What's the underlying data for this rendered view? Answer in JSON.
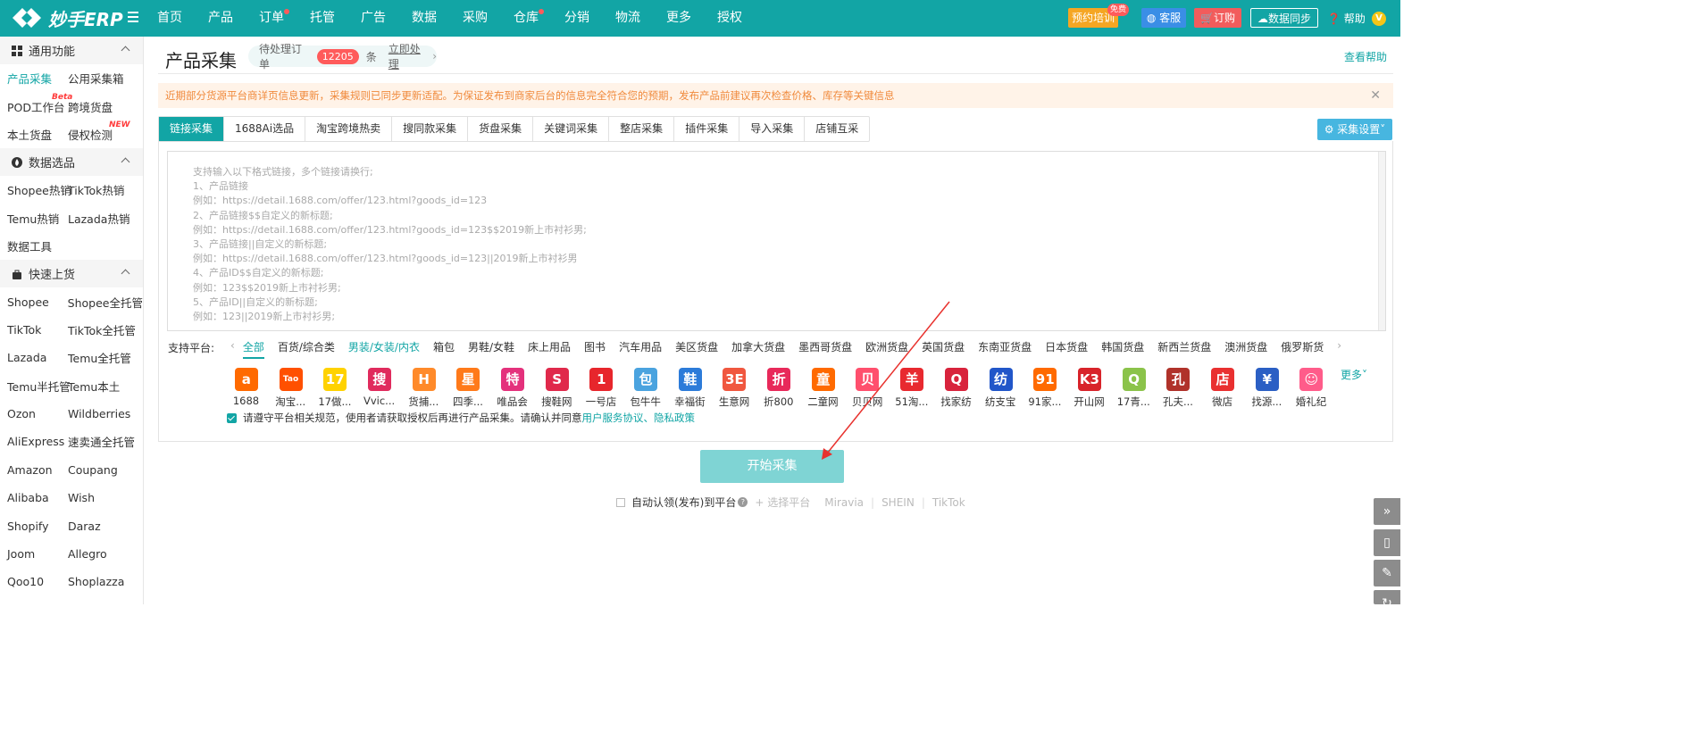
{
  "app": {
    "brand": "妙手ERP"
  },
  "nav": [
    {
      "label": "首页",
      "dot": false
    },
    {
      "label": "产品",
      "dot": false
    },
    {
      "label": "订单",
      "dot": true
    },
    {
      "label": "托管",
      "dot": false
    },
    {
      "label": "广告",
      "dot": false
    },
    {
      "label": "数据",
      "dot": false
    },
    {
      "label": "采购",
      "dot": false
    },
    {
      "label": "仓库",
      "dot": true
    },
    {
      "label": "分销",
      "dot": false
    },
    {
      "label": "物流",
      "dot": false
    },
    {
      "label": "更多",
      "dot": false
    },
    {
      "label": "授权",
      "dot": false
    }
  ],
  "topright": {
    "training": "预约培训",
    "free": "免费",
    "service": "客服",
    "subscribe": "订购",
    "sync": "数据同步",
    "help": "帮助",
    "avatar": "V"
  },
  "sidebar": {
    "sections": [
      {
        "title": "通用功能",
        "icon": "grid-icon",
        "rows": [
          [
            "产品采集",
            "公用采集箱"
          ],
          [
            "POD工作台",
            "跨境货盘"
          ],
          [
            "本土货盘",
            "侵权检测"
          ]
        ]
      },
      {
        "title": "数据选品",
        "icon": "fire-icon",
        "rows": [
          [
            "Shopee热销",
            "TikTok热销"
          ],
          [
            "Temu热销",
            "Lazada热销"
          ],
          [
            "数据工具",
            ""
          ]
        ]
      },
      {
        "title": "快速上货",
        "icon": "bag-icon",
        "rows": [
          [
            "Shopee",
            "Shopee全托管"
          ],
          [
            "TikTok",
            "TikTok全托管"
          ],
          [
            "Lazada",
            "Temu全托管"
          ],
          [
            "Temu半托管",
            "Temu本土"
          ],
          [
            "Ozon",
            "Wildberries"
          ],
          [
            "AliExpress",
            "速卖通全托管"
          ],
          [
            "Amazon",
            "Coupang"
          ],
          [
            "Alibaba",
            "Wish"
          ],
          [
            "Shopify",
            "Daraz"
          ],
          [
            "Joom",
            "Allegro"
          ],
          [
            "Qoo10",
            "Shoplazza"
          ]
        ]
      }
    ],
    "badges": {
      "beta": "Beta",
      "new": "NEW"
    }
  },
  "page": {
    "title": "产品采集",
    "pending_label": "待处理订单",
    "pending_count": "12205",
    "pending_unit": "条",
    "pending_action": "立即处理",
    "view_help": "查看帮助",
    "notice": "近期部分货源平台商详页信息更新，采集规则已同步更新适配。为保证发布到商家后台的信息完全符合您的预期，发布产品前建议再次检查价格、库存等关键信息",
    "tabs": [
      "链接采集",
      "1688Ai选品",
      "淘宝跨境热卖",
      "搜同款采集",
      "货盘采集",
      "关键词采集",
      "整店采集",
      "插件采集",
      "导入采集",
      "店铺互采"
    ],
    "settings": "采集设置",
    "placeholder_lines": [
      "支持输入以下格式链接，多个链接请换行;",
      "1、产品链接",
      "例如：https://detail.1688.com/offer/123.html?goods_id=123",
      "2、产品链接$$自定义的新标题;",
      "例如：https://detail.1688.com/offer/123.html?goods_id=123$$2019新上市衬衫男;",
      "3、产品链接||自定义的新标题;",
      "例如：https://detail.1688.com/offer/123.html?goods_id=123||2019新上市衬衫男",
      "4、产品ID$$自定义的新标题;",
      "例如：123$$2019新上市衬衫男;",
      "5、产品ID||自定义的新标题;",
      "例如：123||2019新上市衬衫男;"
    ],
    "platform_label": "支持平台:",
    "categories": [
      "全部",
      "百货/综合类",
      "男装/女装/内衣",
      "箱包",
      "男鞋/女鞋",
      "床上用品",
      "图书",
      "汽车用品",
      "美区货盘",
      "加拿大货盘",
      "墨西哥货盘",
      "欧洲货盘",
      "英国货盘",
      "东南亚货盘",
      "日本货盘",
      "韩国货盘",
      "新西兰货盘",
      "澳洲货盘",
      "俄罗斯货"
    ],
    "platforms": [
      {
        "name": "1688",
        "glyph": "a",
        "color": "#ff6a00"
      },
      {
        "name": "淘宝...",
        "glyph": "Tao",
        "color": "#ff5000"
      },
      {
        "name": "17做...",
        "glyph": "17",
        "color": "#ffd200"
      },
      {
        "name": "Vvic...",
        "glyph": "搜",
        "color": "#e02b5d"
      },
      {
        "name": "货捕...",
        "glyph": "H",
        "color": "#ff8a2a"
      },
      {
        "name": "四季...",
        "glyph": "星",
        "color": "#ff7a1a"
      },
      {
        "name": "唯品会",
        "glyph": "特",
        "color": "#e4317c"
      },
      {
        "name": "搜鞋网",
        "glyph": "S",
        "color": "#e0294b"
      },
      {
        "name": "一号店",
        "glyph": "1",
        "color": "#e7262c"
      },
      {
        "name": "包牛牛",
        "glyph": "包",
        "color": "#4aa3df"
      },
      {
        "name": "幸福街",
        "glyph": "鞋",
        "color": "#2c7bd9"
      },
      {
        "name": "生意网",
        "glyph": "3E",
        "color": "#f0573f"
      },
      {
        "name": "折800",
        "glyph": "折",
        "color": "#e8295a"
      },
      {
        "name": "二童网",
        "glyph": "童",
        "color": "#ff6a00"
      },
      {
        "name": "贝贝网",
        "glyph": "贝",
        "color": "#ff4f6d"
      },
      {
        "name": "51淘...",
        "glyph": "羊",
        "color": "#e8292f"
      },
      {
        "name": "找家纺",
        "glyph": "Q",
        "color": "#d8233c"
      },
      {
        "name": "纺支宝",
        "glyph": "纺",
        "color": "#2156c9"
      },
      {
        "name": "91家...",
        "glyph": "91",
        "color": "#ff6a00"
      },
      {
        "name": "开山网",
        "glyph": "K3",
        "color": "#d8232a"
      },
      {
        "name": "17青...",
        "glyph": "Q",
        "color": "#8bc34a"
      },
      {
        "name": "孔夫...",
        "glyph": "孔",
        "color": "#b0322a"
      },
      {
        "name": "微店",
        "glyph": "店",
        "color": "#e93030"
      },
      {
        "name": "找源...",
        "glyph": "¥",
        "color": "#2b5fc4"
      },
      {
        "name": "婚礼纪",
        "glyph": "☺",
        "color": "#ff5c8a"
      }
    ],
    "more": "更多",
    "agree_text": "请遵守平台相关规范，使用者请获取授权后再进行产品采集。请确认并同意",
    "agree_link1": "用户服务协议",
    "agree_sep": "、",
    "agree_link2": "隐私政策",
    "start_button": "开始采集",
    "auto_claim": "自动认领(发布)到平台",
    "select_platform": "+ 选择平台",
    "auto_platforms": [
      "Miravia",
      "SHEIN",
      "TikTok"
    ]
  },
  "colors": {
    "brand": "#12a5a5",
    "arrow": "#e8322e"
  }
}
